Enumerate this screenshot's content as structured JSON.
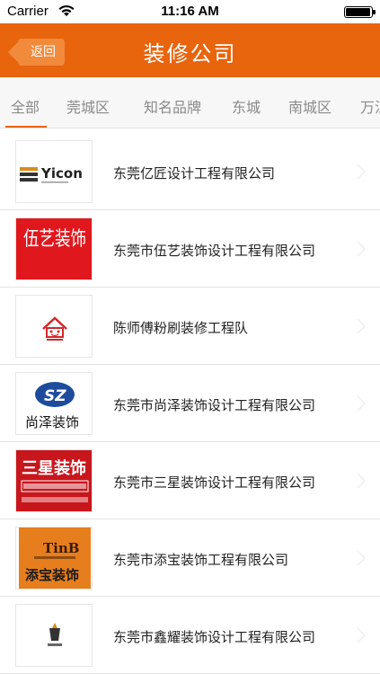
{
  "status_bar": {
    "carrier": "Carrier",
    "time": "11:16 AM",
    "battery_level": 0.95
  },
  "header": {
    "back_label": "返回",
    "title": "装修公司",
    "accent_color": "#e8640d"
  },
  "tabs": [
    {
      "label": "全部",
      "active": true
    },
    {
      "label": "莞城区",
      "active": false
    },
    {
      "label": "知名品牌",
      "active": false
    },
    {
      "label": "东城",
      "active": false
    },
    {
      "label": "南城区",
      "active": false
    },
    {
      "label": "万江",
      "active": false
    }
  ],
  "companies": [
    {
      "name": "东莞亿匠设计工程有限公司",
      "logo": "yicon-logo",
      "logo_text": "Yicon"
    },
    {
      "name": "东莞市伍艺装饰设计工程有限公司",
      "logo": "wuyi-logo",
      "logo_text": "伍艺装饰"
    },
    {
      "name": "陈师傅粉刷装修工程队",
      "logo": "house-logo",
      "logo_text": ""
    },
    {
      "name": "东莞市尚泽装饰设计工程有限公司",
      "logo": "shangze-logo",
      "logo_text": "尚泽装饰"
    },
    {
      "name": "东莞市三星装饰设计工程有限公司",
      "logo": "sanxing-logo",
      "logo_text": "三星装饰"
    },
    {
      "name": "东莞市添宝装饰工程有限公司",
      "logo": "tianbao-logo",
      "logo_text": "添宝装饰"
    },
    {
      "name": "东莞市鑫耀装饰设计工程有限公司",
      "logo": "xinyao-logo",
      "logo_text": ""
    }
  ]
}
